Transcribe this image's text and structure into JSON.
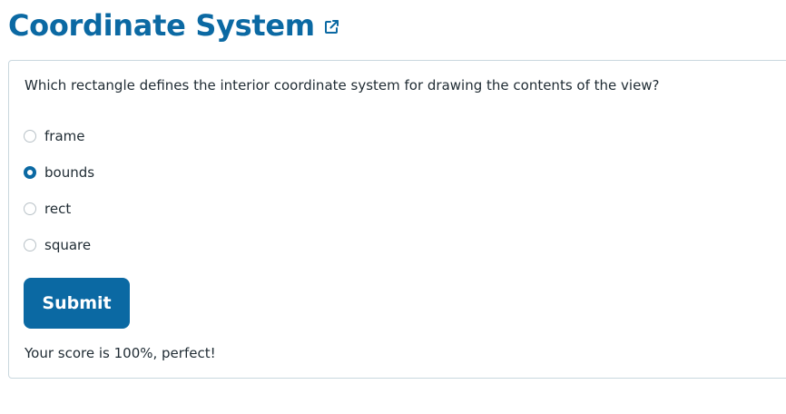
{
  "header": {
    "title": "Coordinate System",
    "link_icon": "external-link-icon"
  },
  "quiz": {
    "question": "Which rectangle defines the interior coordinate system for drawing the contents of the view?",
    "options": [
      {
        "label": "frame",
        "selected": false
      },
      {
        "label": "bounds",
        "selected": true
      },
      {
        "label": "rect",
        "selected": false
      },
      {
        "label": "square",
        "selected": false
      }
    ],
    "submit_label": "Submit",
    "result": "Your score is 100%, perfect!"
  },
  "colors": {
    "accent": "#0b69a3",
    "text": "#1f2b33",
    "border": "#c9d7de"
  }
}
